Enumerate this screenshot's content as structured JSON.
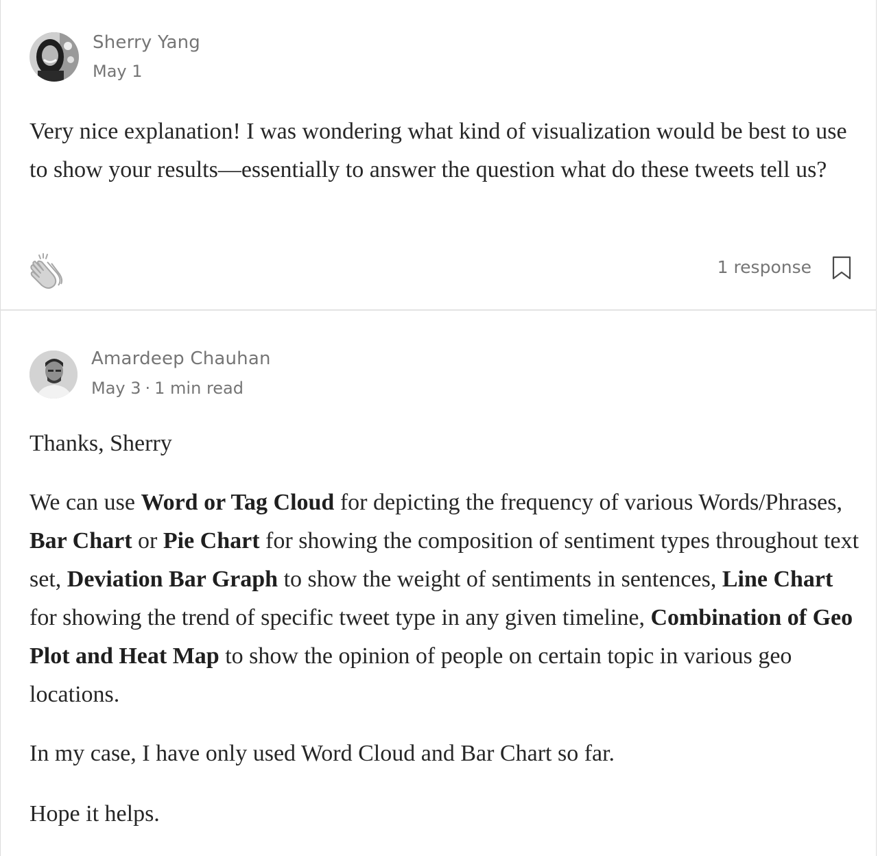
{
  "comments": [
    {
      "author": "Sherry Yang",
      "date": "May 1",
      "text": "Very nice explanation! I was wondering what kind of visualization would be best to use to show your results—essentially to answer the question what do these tweets tell us?",
      "actions": {
        "clap_icon": "clap-icon",
        "responses_label": "1 response",
        "bookmark_icon": "bookmark-icon"
      }
    },
    {
      "author": "Amardeep Chauhan",
      "date": "May 3",
      "separator": "·",
      "read_time": "1 min read",
      "paragraphs": {
        "greeting": "Thanks, Sherry",
        "main": [
          {
            "text": "We can use ",
            "bold": false
          },
          {
            "text": "Word or Tag Cloud",
            "bold": true
          },
          {
            "text": " for depicting the frequency of various Words/Phrases, ",
            "bold": false
          },
          {
            "text": "Bar Chart",
            "bold": true
          },
          {
            "text": " or ",
            "bold": false
          },
          {
            "text": "Pie Chart",
            "bold": true
          },
          {
            "text": " for showing the composition of sentiment types throughout text set, ",
            "bold": false
          },
          {
            "text": "Deviation Bar Graph",
            "bold": true
          },
          {
            "text": " to show the weight of sentiments in sentences, ",
            "bold": false
          },
          {
            "text": "Line Chart",
            "bold": true
          },
          {
            "text": " for showing the trend of specific tweet type in any given timeline, ",
            "bold": false
          },
          {
            "text": "Combination of Geo Plot and Heat Map",
            "bold": true
          },
          {
            "text": " to show the opinion of people on certain topic in various geo locations.",
            "bold": false
          }
        ],
        "case": "In my case, I have only used Word Cloud and Bar Chart so far.",
        "closing": "Hope it helps."
      }
    }
  ],
  "colors": {
    "text": "#262626",
    "meta": "#757575",
    "divider": "#e3e3e3"
  }
}
